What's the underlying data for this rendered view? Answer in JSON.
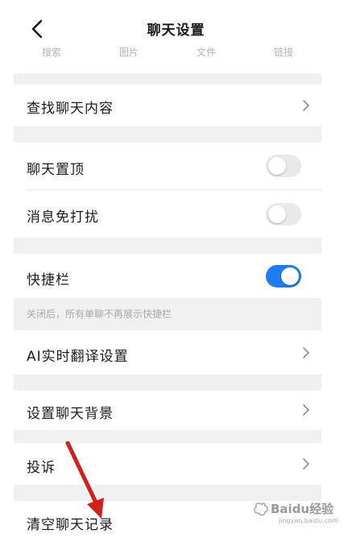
{
  "header": {
    "title": "聊天设置"
  },
  "tab_strip": [
    "搜索",
    "图片",
    "文件",
    "链接"
  ],
  "rows": {
    "search_chat": "查找聊天内容",
    "pin_chat": "聊天置顶",
    "mute": "消息免打扰",
    "shortcut_bar": "快捷栏",
    "ai_translate": "AI实时翻译设置",
    "chat_background": "设置聊天背景",
    "report": "投诉",
    "clear_history": "清空聊天记录"
  },
  "toggles": {
    "pin_chat": false,
    "mute": false,
    "shortcut_bar": true
  },
  "hint": "关闭后，所有单聊不再展示快捷栏",
  "watermark": {
    "text": "Baidu经验",
    "subtext": "jingyan.baidu.com"
  },
  "colors": {
    "accent": "#1f7cf0",
    "annotation_arrow": "#d0211c",
    "section_gap": "#f0f0f0"
  }
}
